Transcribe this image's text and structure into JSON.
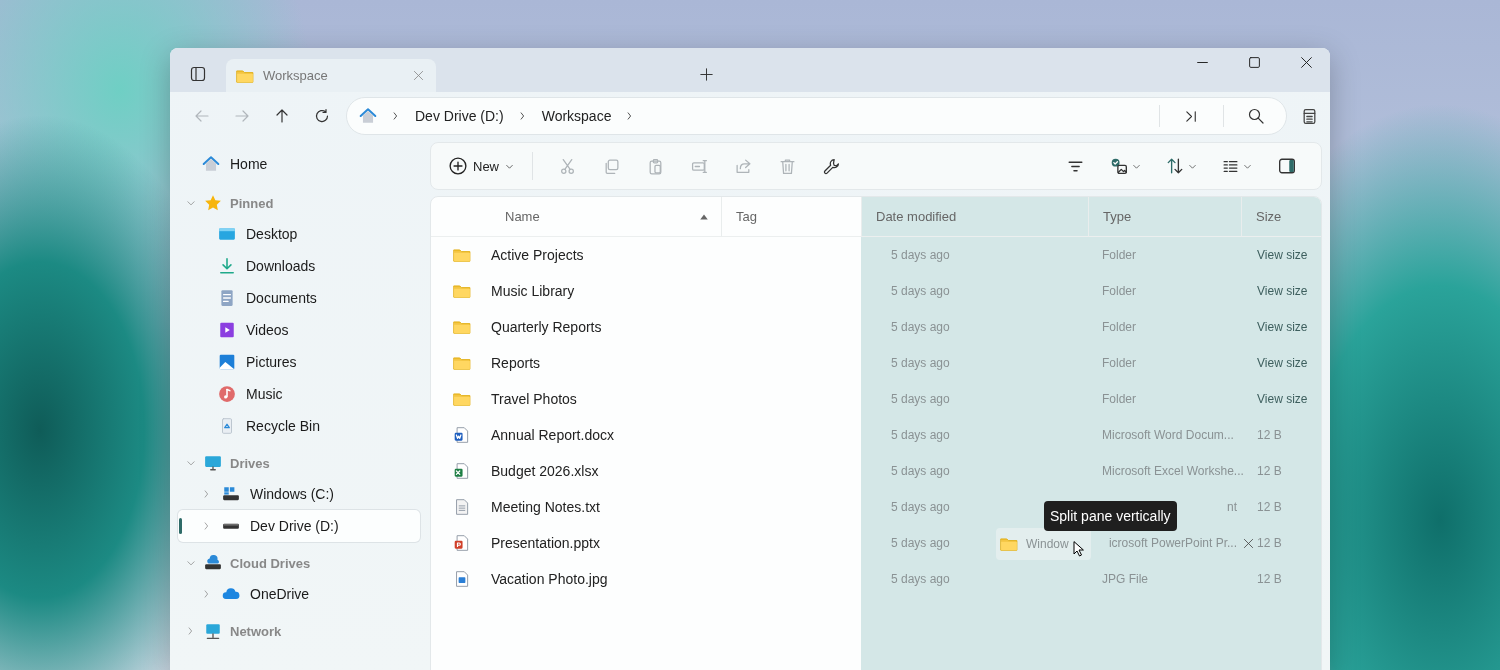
{
  "tabs": [
    {
      "label": "Workspace",
      "selected": true
    }
  ],
  "nav": [
    {
      "kind": "back",
      "disabled": true
    },
    {
      "kind": "forward",
      "disabled": true
    },
    {
      "kind": "up",
      "disabled": false
    },
    {
      "kind": "refresh",
      "disabled": false
    }
  ],
  "address": {
    "crumbs": [
      "Dev Drive (D:)",
      "Workspace"
    ]
  },
  "toolbar": {
    "new_label": "New",
    "actions": [
      {
        "kind": "cut",
        "disabled": true
      },
      {
        "kind": "copy",
        "disabled": true
      },
      {
        "kind": "paste",
        "disabled": true
      },
      {
        "kind": "rename",
        "disabled": true
      },
      {
        "kind": "share",
        "disabled": true
      },
      {
        "kind": "delete",
        "disabled": true
      },
      {
        "kind": "properties",
        "disabled": false
      }
    ],
    "view_actions": [
      {
        "kind": "filter",
        "menu": false
      },
      {
        "kind": "thumbnails",
        "menu": true
      },
      {
        "kind": "sort",
        "menu": true
      },
      {
        "kind": "layout",
        "menu": true
      },
      {
        "kind": "pane",
        "menu": false
      }
    ]
  },
  "sidebar": {
    "home": {
      "label": "Home"
    },
    "sections": [
      {
        "label": "Pinned",
        "kind": "pinned",
        "expanded": true,
        "items": [
          {
            "label": "Desktop",
            "kind": "desktop",
            "selected": false
          },
          {
            "label": "Downloads",
            "kind": "downloads",
            "selected": false
          },
          {
            "label": "Documents",
            "kind": "documents",
            "selected": false
          },
          {
            "label": "Videos",
            "kind": "videos",
            "selected": false
          },
          {
            "label": "Pictures",
            "kind": "pictures",
            "selected": false
          },
          {
            "label": "Music",
            "kind": "music",
            "selected": false
          },
          {
            "label": "Recycle Bin",
            "kind": "recycle",
            "selected": false
          }
        ]
      },
      {
        "label": "Drives",
        "kind": "drives",
        "expanded": true,
        "items": [
          {
            "label": "Windows (C:)",
            "kind": "system-drive",
            "selected": false,
            "expanded": false
          },
          {
            "label": "Dev Drive (D:)",
            "kind": "drive",
            "selected": true,
            "expanded": false
          }
        ]
      },
      {
        "label": "Cloud Drives",
        "kind": "cloud-drives",
        "expanded": true,
        "items": [
          {
            "label": "OneDrive",
            "kind": "cloud",
            "selected": false,
            "expanded": false
          }
        ]
      },
      {
        "label": "Network",
        "kind": "network",
        "expanded": false
      }
    ]
  },
  "file_list": {
    "split_preview": true,
    "columns": [
      {
        "label": "Name",
        "sorted": true
      },
      {
        "label": "Tag",
        "sorted": false
      },
      {
        "label": "Date modified",
        "sorted": false
      },
      {
        "label": "Type",
        "sorted": false
      },
      {
        "label": "Size",
        "sorted": false
      }
    ],
    "rows": [
      {
        "name": "Active Projects",
        "kind": "folder",
        "date": "5 days ago",
        "type": "Folder",
        "size": "View size"
      },
      {
        "name": "Music Library",
        "kind": "folder",
        "date": "5 days ago",
        "type": "Folder",
        "size": "View size"
      },
      {
        "name": "Quarterly Reports",
        "kind": "folder",
        "date": "5 days ago",
        "type": "Folder",
        "size": "View size"
      },
      {
        "name": "Reports",
        "kind": "folder",
        "date": "5 days ago",
        "type": "Folder",
        "size": "View size"
      },
      {
        "name": "Travel Photos",
        "kind": "folder",
        "date": "5 days ago",
        "type": "Folder",
        "size": "View size"
      },
      {
        "name": "Annual Report.docx",
        "kind": "word",
        "date": "5 days ago",
        "type": "Microsoft Word Docum...",
        "size": "12 B"
      },
      {
        "name": "Budget 2026.xlsx",
        "kind": "excel",
        "date": "5 days ago",
        "type": "Microsoft Excel Workshe...",
        "size": "12 B"
      },
      {
        "name": "Meeting Notes.txt",
        "kind": "text",
        "date": "5 days ago",
        "type": "nt",
        "size": "12 B",
        "type_clipped": true
      },
      {
        "name": "Presentation.pptx",
        "kind": "powerpoint",
        "date": "5 days ago",
        "type": "icrosoft PowerPoint Pr...",
        "size": "12 B",
        "type_clipped": true
      },
      {
        "name": "Vacation Photo.jpg",
        "kind": "image",
        "date": "5 days ago",
        "type": "JPG File",
        "size": "12 B"
      }
    ]
  },
  "drag_ghost": {
    "label": "Window"
  },
  "tooltip": {
    "text": "Split pane vertically"
  }
}
